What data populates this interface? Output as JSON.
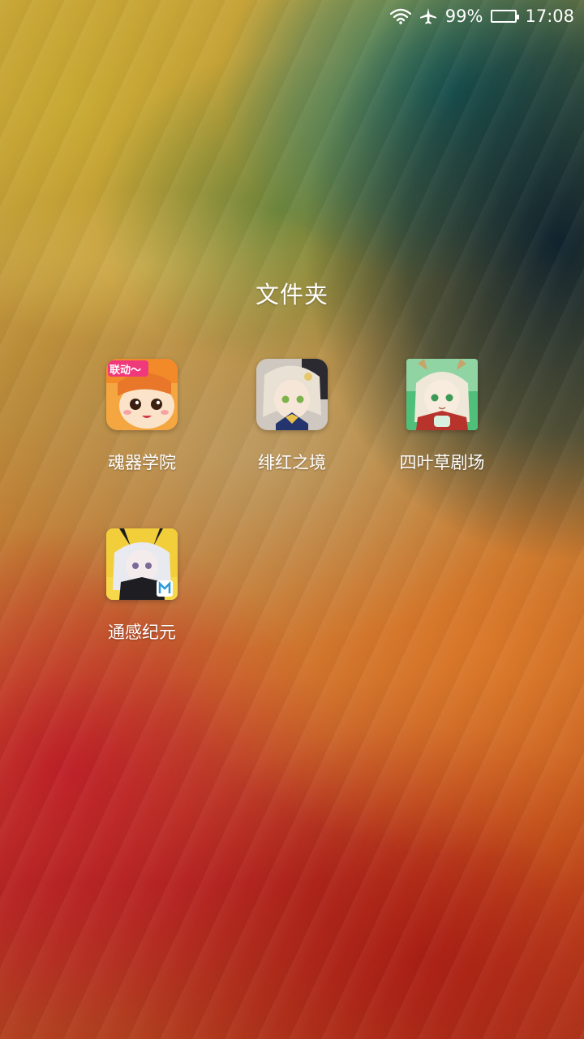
{
  "status_bar": {
    "wifi_icon": "wifi-icon",
    "airplane_icon": "airplane-icon",
    "battery_percent_text": "99%",
    "battery_level": 0.99,
    "time": "17:08"
  },
  "folder": {
    "title": "文件夹",
    "apps": [
      {
        "label": "魂器学院",
        "icon": "hunqi-xueyuan-app-icon",
        "badge_text": "联动～"
      },
      {
        "label": "绯红之境",
        "icon": "feihong-zhijing-app-icon"
      },
      {
        "label": "四叶草剧场",
        "icon": "siyecao-juchang-app-icon"
      },
      {
        "label": "通感纪元",
        "icon": "tonggan-jiyuan-app-icon"
      }
    ]
  }
}
